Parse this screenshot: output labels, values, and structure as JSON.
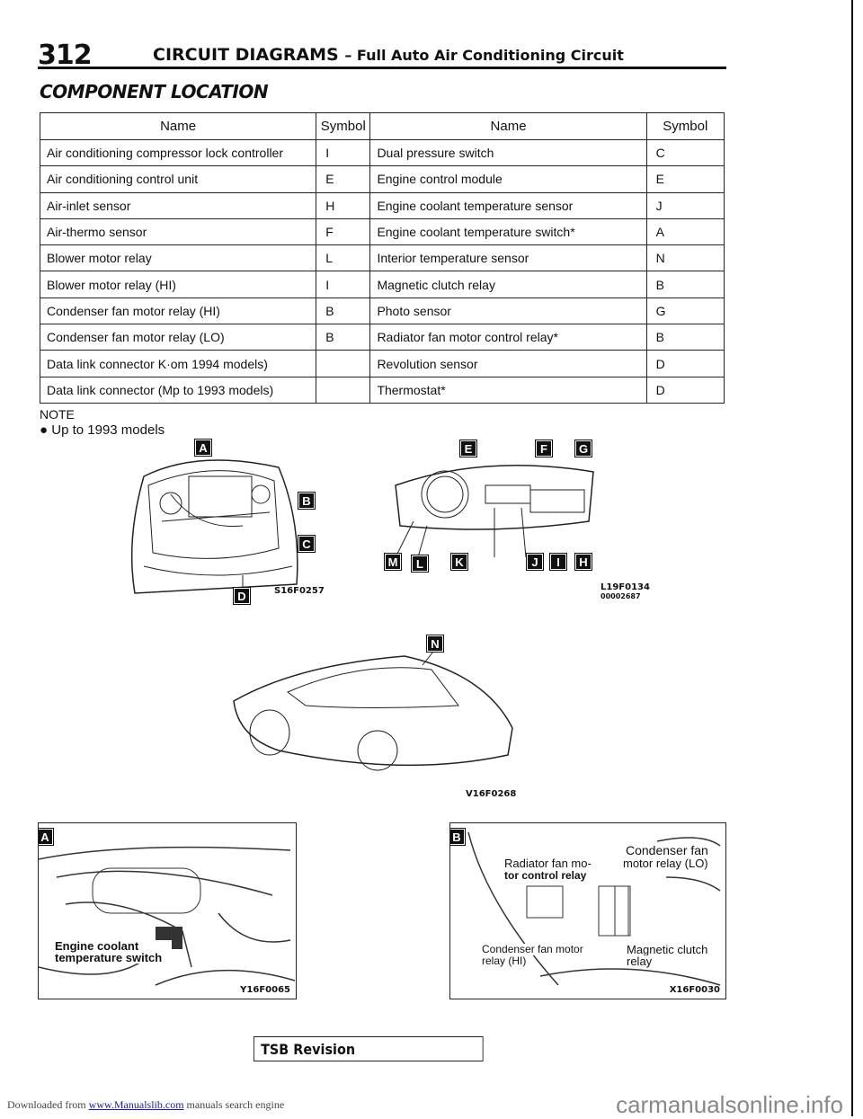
{
  "header": {
    "page_number": "312",
    "title": "CIRCUIT DIAGRAMS",
    "subtitle": "– Full Auto Air Conditioning Circuit"
  },
  "section_title": "COMPONENT LOCATION",
  "table": {
    "headers": {
      "name": "Name",
      "symbol": "Symbol"
    },
    "left": [
      {
        "name": "Air conditioning compressor lock controller",
        "symbol": "I"
      },
      {
        "name": "Air conditioning control unit",
        "symbol": "E"
      },
      {
        "name": "Air-inlet sensor",
        "symbol": "H"
      },
      {
        "name": "Air-thermo sensor",
        "symbol": "F"
      },
      {
        "name": "Blower motor relay",
        "symbol": "L"
      },
      {
        "name": "Blower motor relay (HI)",
        "symbol": "I"
      },
      {
        "name": "Condenser fan motor relay (HI)",
        "symbol": "B"
      },
      {
        "name": "Condenser fan motor relay (LO)",
        "symbol": "B"
      },
      {
        "name": "Data link connector K·om 1994 models)",
        "symbol": ""
      },
      {
        "name": "Data link connector (Mp to 1993 models)",
        "symbol": ""
      }
    ],
    "right": [
      {
        "name": "Dual pressure switch",
        "symbol": "C"
      },
      {
        "name": "Engine control module",
        "symbol": "E"
      },
      {
        "name": "Engine coolant temperature sensor",
        "symbol": "J"
      },
      {
        "name": "Engine coolant temperature switch*",
        "symbol": "A"
      },
      {
        "name": "Interior temperature sensor",
        "symbol": "N"
      },
      {
        "name": "Magnetic clutch relay",
        "symbol": "B"
      },
      {
        "name": "Photo sensor",
        "symbol": "G"
      },
      {
        "name": "Radiator fan motor control relay*",
        "symbol": "B"
      },
      {
        "name": "Revolution sensor",
        "symbol": "D"
      },
      {
        "name": "Thermostat*",
        "symbol": "D"
      }
    ]
  },
  "note": {
    "title": "NOTE",
    "items": [
      "Up to 1993 models"
    ]
  },
  "figures": {
    "engine": {
      "code": "S16F0257",
      "badges": [
        "A",
        "B",
        "C",
        "D"
      ]
    },
    "dash": {
      "code": "L19F0134",
      "code2": "00002687",
      "badges_top": [
        "E",
        "F",
        "G"
      ],
      "badges_bottom": [
        "M",
        "L",
        "K",
        "J",
        "I",
        "H"
      ]
    },
    "car": {
      "code": "V16F0268",
      "badge": "N"
    },
    "photo_a": {
      "badge": "A",
      "label": "Engine coolant temperature switch",
      "code": "Y16F0065"
    },
    "photo_b": {
      "badge": "B",
      "labels": {
        "radiator": "Radiator fan mo-",
        "radiator2": "tor control relay",
        "cond_lo": "Condenser fan",
        "cond_lo2": "motor relay (LO)",
        "cond_hi": "Condenser fan motor",
        "cond_hi2": "relay (HI)",
        "mag": "Magnetic clutch",
        "mag2": "relay"
      },
      "code": "X16F0030"
    }
  },
  "footer": {
    "tsb": "TSB Revision",
    "downloaded": "Downloaded from",
    "link": "www.Manualslib.com",
    "tail": "manuals search engine",
    "brand": "carmanualsonline.info"
  }
}
